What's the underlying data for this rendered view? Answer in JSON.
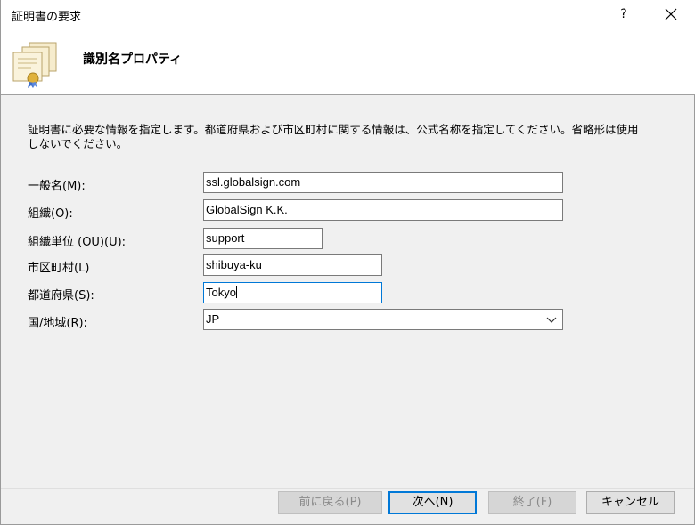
{
  "window": {
    "title": "証明書の要求",
    "help_label": "?"
  },
  "header": {
    "title": "識別名プロパティ"
  },
  "description": "証明書に必要な情報を指定します。都道府県および市区町村に関する情報は、公式名称を指定してください。省略形は使用しないでください。",
  "form": {
    "common_name": {
      "label": "一般名(M):",
      "value": "ssl.globalsign.com"
    },
    "organization": {
      "label": "組織(O):",
      "value": "GlobalSign K.K."
    },
    "org_unit": {
      "label": "組織単位 (OU)(U):",
      "value": "support"
    },
    "city": {
      "label": "市区町村(L)",
      "value": "shibuya-ku"
    },
    "state": {
      "label": "都道府県(S):",
      "value": "Tokyo"
    },
    "country": {
      "label": "国/地域(R):",
      "value": "JP"
    }
  },
  "buttons": {
    "back": "前に戻る(P)",
    "next": "次へ(N)",
    "finish": "終了(F)",
    "cancel": "キャンセル"
  },
  "colors": {
    "accent": "#0078d7",
    "window_bg": "#f0f0f0",
    "header_bg": "#ffffff"
  },
  "icons": {
    "header": "certificate-stack-icon",
    "close": "close-icon",
    "dropdown": "chevron-down-icon"
  }
}
